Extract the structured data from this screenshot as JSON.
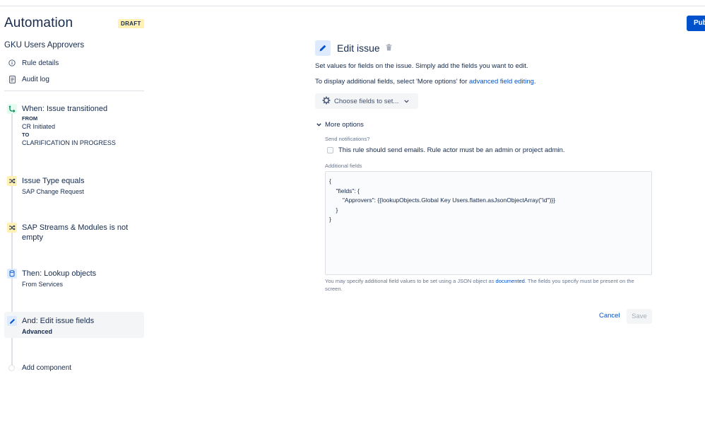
{
  "header": {
    "title": "Automation",
    "status_badge": "DRAFT",
    "publish_label": "Pub"
  },
  "sidebar": {
    "rule_name": "GKU Users Approvers",
    "links": [
      {
        "label": "Rule details",
        "icon": "info-icon"
      },
      {
        "label": "Audit log",
        "icon": "clipboard-icon"
      }
    ],
    "components": [
      {
        "title": "When: Issue transitioned",
        "from_label": "FROM",
        "from_value": "CR Initiated",
        "to_label": "TO",
        "to_value": "CLARIFICATION IN PROGRESS",
        "icon": "transition-icon"
      },
      {
        "title": "Issue Type equals",
        "subtitle": "SAP Change Request",
        "icon": "shuffle-icon"
      },
      {
        "title": "SAP Streams & Modules is not",
        "title2": "empty",
        "icon": "shuffle-icon"
      },
      {
        "title": "Then: Lookup objects",
        "subtitle": "From Services",
        "icon": "cylinder-icon"
      },
      {
        "title": "And: Edit issue fields",
        "subtitle": "Advanced",
        "icon": "pencil-icon"
      }
    ],
    "add_component_label": "Add component"
  },
  "main": {
    "title": "Edit issue",
    "description": "Set values for fields on the issue. Simply add the fields you want to edit.",
    "more_prefix": "To display additional fields, select 'More options' for ",
    "more_link": "advanced field editing",
    "more_suffix": ".",
    "choose_fields_label": "Choose fields to set...",
    "more_options_label": "More options",
    "send_notifications_label": "Send notifications?",
    "send_emails_text": "This rule should send emails. Rule actor must be an admin or project admin.",
    "additional_fields_label": "Additional fields",
    "additional_fields_value": "{\n    \"fields\": {\n        \"Approvers\": {{lookupObjects.Global Key Users.flatten.asJsonObjectArray(\"id\")}}\n    }\n}",
    "help_prefix": "You may specify additional field values to be set using a JSON object as ",
    "help_link": "documented",
    "help_suffix": ". The fields you specify must be present on the screen.",
    "cancel_label": "Cancel",
    "save_label": "Save"
  },
  "colors": {
    "accent": "#0052cc",
    "draft_bg": "#fff0b3",
    "trigger_icon_bg": "#e3fcef",
    "condition_icon_bg": "#fff0b3",
    "action_icon_bg": "#deebff"
  }
}
